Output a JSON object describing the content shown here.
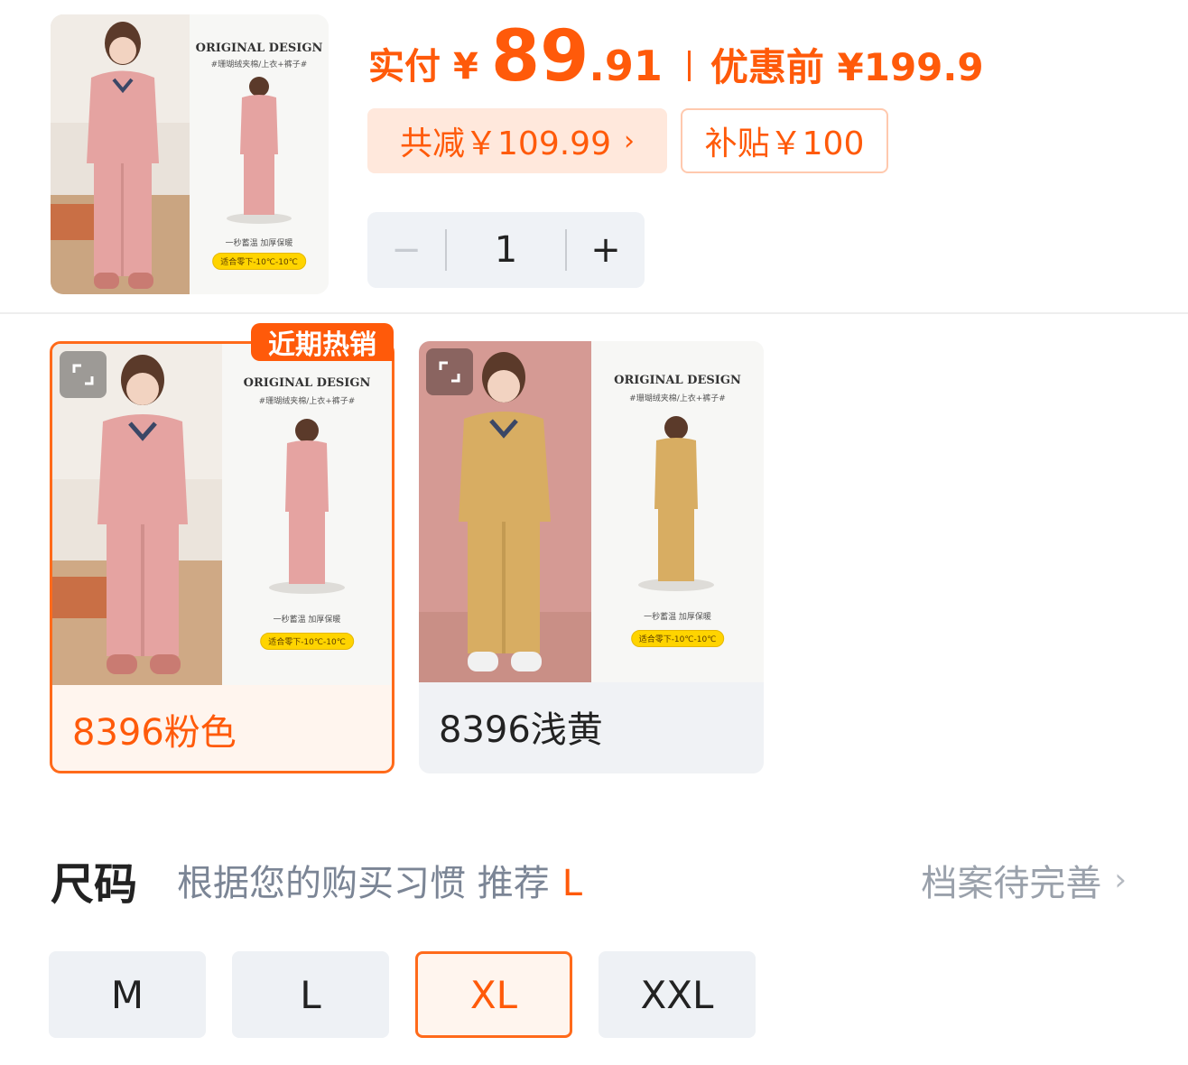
{
  "summary": {
    "pay_label": "实付",
    "currency": "¥",
    "price_int": "89",
    "price_dec": ".91",
    "original_price": "优惠前 ¥199.9",
    "discount_chip": "共减￥109.99",
    "subsidy_chip": "补贴￥100",
    "quantity": "1",
    "minus": "−",
    "plus": "+"
  },
  "thumb_art": {
    "brand": "ORIGINAL DESIGN",
    "sub": "#珊瑚绒夹棉/上衣+裤子#",
    "slogan": "一秒蓄温 加厚保暖",
    "tag": "适合零下-10℃-10℃",
    "tag_top": "适合零下-10℃-10℃"
  },
  "variants": [
    {
      "label": "8396粉色",
      "badge": "近期热销",
      "selected": true,
      "color": "#e5a3a1"
    },
    {
      "label": "8396浅黄",
      "selected": false,
      "color": "#d8ad62"
    }
  ],
  "size": {
    "title": "尺码",
    "tip": "根据您的购买习惯 推荐",
    "recommend": "L",
    "profile_link": "档案待完善",
    "options": [
      "M",
      "L",
      "XL",
      "XXL"
    ],
    "selected": "XL"
  },
  "colors": {
    "accent": "#ff5a0a",
    "chip_bg": "#ffe8dc",
    "muted_text": "#7b8595",
    "button_bg": "#eef1f5"
  }
}
